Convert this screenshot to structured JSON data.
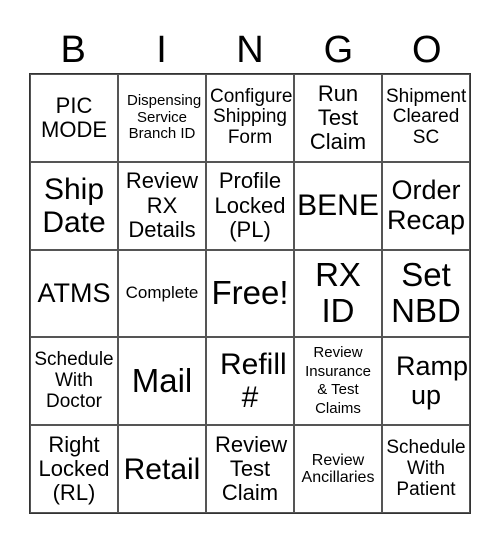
{
  "header": [
    "B",
    "I",
    "N",
    "G",
    "O"
  ],
  "cells": [
    [
      "PIC MODE",
      "Dispensing Service Branch ID",
      "Configure Shipping Form",
      "Run Test Claim",
      "Shipment Cleared SC"
    ],
    [
      "Ship Date",
      "Review RX Details",
      "Profile Locked (PL)",
      "BENE",
      "Order Recap"
    ],
    [
      "ATMS",
      "Complete",
      "Free!",
      "RX ID",
      "Set NBD"
    ],
    [
      "Schedule With Doctor",
      "Mail",
      "Refill #",
      "Review Insurance & Test Claims",
      "Ramp up"
    ],
    [
      "Right Locked (RL)",
      "Retail",
      "Review Test Claim",
      "Review Ancillaries",
      "Schedule With Patient"
    ]
  ]
}
